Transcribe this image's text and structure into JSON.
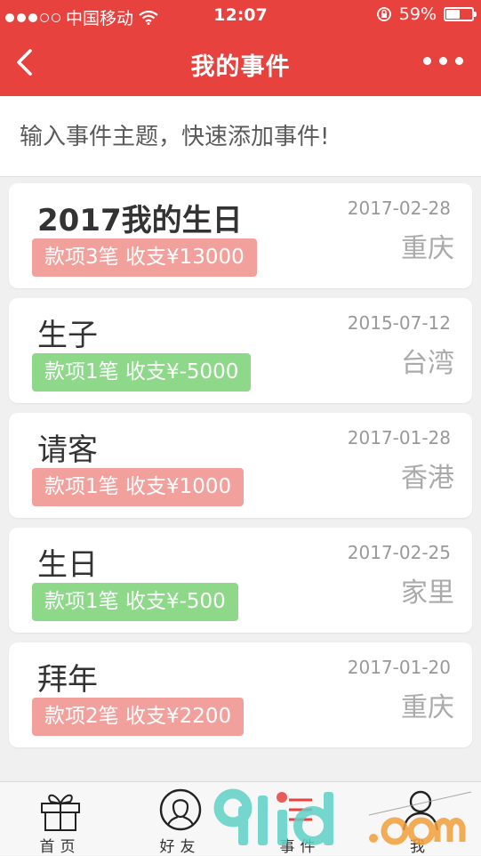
{
  "status_bar": {
    "carrier": "中国移动",
    "time": "12:07",
    "battery_percent": "59%",
    "battery_level": 0.59
  },
  "nav": {
    "title": "我的事件"
  },
  "quick_add": {
    "placeholder": "输入事件主题，快速添加事件!"
  },
  "events": [
    {
      "title": "2017我的生日",
      "summary": "款项3笔 收支¥13000",
      "date": "2017-02-28",
      "place": "重庆",
      "status": "red"
    },
    {
      "title": "生子",
      "summary": "款项1笔 收支¥-5000",
      "date": "2015-07-12",
      "place": "台湾",
      "status": "green"
    },
    {
      "title": "请客",
      "summary": "款项1笔 收支¥1000",
      "date": "2017-01-28",
      "place": "香港",
      "status": "red"
    },
    {
      "title": "生日",
      "summary": "款项1笔 收支¥-500",
      "date": "2017-02-25",
      "place": "家里",
      "status": "green"
    },
    {
      "title": "拜年",
      "summary": "款项2笔 收支¥2200",
      "date": "2017-01-20",
      "place": "重庆",
      "status": "red"
    }
  ],
  "tabs": [
    {
      "label": "首页",
      "icon": "gift-icon"
    },
    {
      "label": "好友",
      "icon": "friend-icon"
    },
    {
      "label": "事件",
      "icon": "event-icon"
    },
    {
      "label": "我",
      "icon": "profile-icon"
    }
  ],
  "colors": {
    "brand_red": "#e8423f",
    "badge_red": "#f2a09c",
    "badge_green": "#8ed88a"
  }
}
